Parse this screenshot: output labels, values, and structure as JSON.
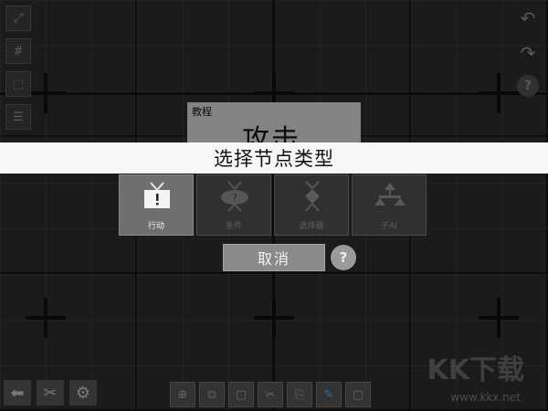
{
  "dialog": {
    "title": "选择节点类型",
    "node_types": [
      {
        "label": "行动",
        "icon": "action-node-icon",
        "active": true
      },
      {
        "label": "条件",
        "icon": "condition-node-icon",
        "active": false
      },
      {
        "label": "选择器",
        "icon": "selector-node-icon",
        "active": false
      },
      {
        "label": "子AI",
        "icon": "sub-ai-node-icon",
        "active": false
      }
    ],
    "cancel_label": "取消",
    "help_label": "?"
  },
  "tutorial": {
    "title": "教程",
    "heading": "攻击"
  },
  "toolbar_right": {
    "help_label": "?"
  },
  "watermark": {
    "text": "KK下载",
    "url": "www.kkx.net"
  },
  "colors": {
    "banner": "#f7f7f7",
    "active_card": "#6f6f6f",
    "cancel_button": "#8a8a8a",
    "grid": "#2a2a2a"
  }
}
